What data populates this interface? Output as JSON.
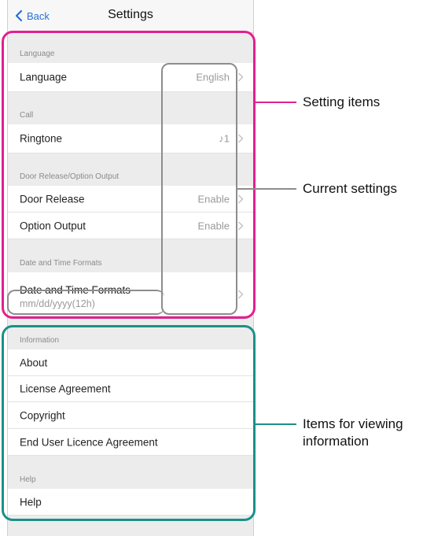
{
  "navbar": {
    "back_label": "Back",
    "title": "Settings"
  },
  "sections": {
    "language": "Language",
    "call": "Call",
    "door": "Door Release/Option Output",
    "datetime": "Date and Time Formats",
    "information": "Information",
    "help": "Help"
  },
  "rows": {
    "language": {
      "label": "Language",
      "value": "English"
    },
    "ringtone": {
      "label": "Ringtone",
      "value": "♪1"
    },
    "door_release": {
      "label": "Door Release",
      "value": "Enable"
    },
    "option_output": {
      "label": "Option Output",
      "value": "Enable"
    },
    "datetime": {
      "label": "Date and Time Formats",
      "value": "mm/dd/yyyy(12h)"
    },
    "about": {
      "label": "About"
    },
    "license": {
      "label": "License Agreement"
    },
    "copyright": {
      "label": "Copyright"
    },
    "eula": {
      "label": "End User Licence Agreement"
    },
    "help": {
      "label": "Help"
    }
  },
  "annotations": {
    "setting_items": "Setting items",
    "current_settings": "Current settings",
    "viewing_info_line1": "Items for viewing",
    "viewing_info_line2": "information"
  },
  "colors": {
    "pink": "#e2208f",
    "teal": "#1a9187",
    "gray": "#8d8d8d",
    "link": "#2a6fd6"
  }
}
